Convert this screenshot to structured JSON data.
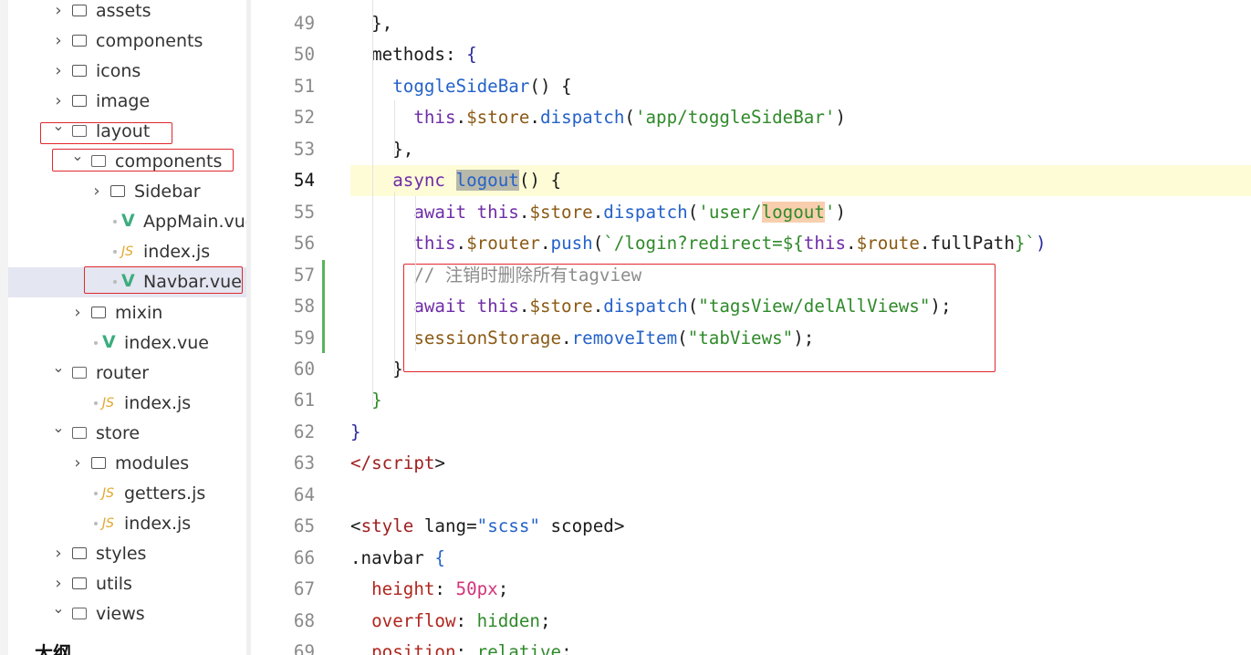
{
  "explorer": {
    "items": [
      {
        "label": "assets",
        "type": "folder",
        "state": "collapsed",
        "depth": 0
      },
      {
        "label": "components",
        "type": "folder",
        "state": "collapsed",
        "depth": 0
      },
      {
        "label": "icons",
        "type": "folder",
        "state": "collapsed",
        "depth": 0
      },
      {
        "label": "image",
        "type": "folder",
        "state": "collapsed",
        "depth": 0
      },
      {
        "label": "layout",
        "type": "folder",
        "state": "expanded",
        "depth": 0
      },
      {
        "label": "components",
        "type": "folder",
        "state": "expanded",
        "depth": 1
      },
      {
        "label": "Sidebar",
        "type": "folder",
        "state": "collapsed",
        "depth": 2
      },
      {
        "label": "AppMain.vue",
        "type": "vue",
        "depth": 2
      },
      {
        "label": "index.js",
        "type": "js",
        "depth": 2
      },
      {
        "label": "Navbar.vue",
        "type": "vue",
        "depth": 2,
        "selected": true
      },
      {
        "label": "mixin",
        "type": "folder",
        "state": "collapsed",
        "depth": 1
      },
      {
        "label": "index.vue",
        "type": "vue",
        "depth": 1
      },
      {
        "label": "router",
        "type": "folder",
        "state": "expanded",
        "depth": 0
      },
      {
        "label": "index.js",
        "type": "js",
        "depth": 1
      },
      {
        "label": "store",
        "type": "folder",
        "state": "expanded",
        "depth": 0
      },
      {
        "label": "modules",
        "type": "folder",
        "state": "collapsed",
        "depth": 1
      },
      {
        "label": "getters.js",
        "type": "js",
        "depth": 1
      },
      {
        "label": "index.js",
        "type": "js",
        "depth": 1
      },
      {
        "label": "styles",
        "type": "folder",
        "state": "collapsed",
        "depth": 0
      },
      {
        "label": "utils",
        "type": "folder",
        "state": "collapsed",
        "depth": 0
      },
      {
        "label": "views",
        "type": "folder",
        "state": "expanded",
        "depth": 0
      }
    ],
    "outline_title": "大纲",
    "file_icon_js": "JS",
    "file_icon_vue": "V"
  },
  "editor": {
    "current_line": 54,
    "lines": [
      {
        "n": "49",
        "tokens": [
          {
            "t": "  },",
            "c": ""
          }
        ]
      },
      {
        "n": "50",
        "tokens": [
          {
            "t": "  methods: ",
            "c": ""
          },
          {
            "t": "{",
            "c": "brace"
          }
        ]
      },
      {
        "n": "51",
        "tokens": [
          {
            "t": "    ",
            "c": ""
          },
          {
            "t": "toggleSideBar",
            "c": "fn"
          },
          {
            "t": "() {",
            "c": ""
          }
        ]
      },
      {
        "n": "52",
        "tokens": [
          {
            "t": "      ",
            "c": ""
          },
          {
            "t": "this",
            "c": "kw"
          },
          {
            "t": ".",
            "c": ""
          },
          {
            "t": "$store",
            "c": "prop"
          },
          {
            "t": ".",
            "c": ""
          },
          {
            "t": "dispatch",
            "c": "fn"
          },
          {
            "t": "(",
            "c": ""
          },
          {
            "t": "'app/toggleSideBar'",
            "c": "str"
          },
          {
            "t": ")",
            "c": ""
          }
        ]
      },
      {
        "n": "53",
        "tokens": [
          {
            "t": "    },",
            "c": ""
          }
        ]
      },
      {
        "n": "54",
        "tokens": [
          {
            "t": "    ",
            "c": ""
          },
          {
            "t": "async ",
            "c": "kw"
          },
          {
            "t": "logout",
            "c": "fn hl-grey"
          },
          {
            "t": "() {",
            "c": ""
          }
        ]
      },
      {
        "n": "55",
        "tokens": [
          {
            "t": "      ",
            "c": ""
          },
          {
            "t": "await ",
            "c": "kw"
          },
          {
            "t": "this",
            "c": "kw"
          },
          {
            "t": ".",
            "c": ""
          },
          {
            "t": "$store",
            "c": "prop"
          },
          {
            "t": ".",
            "c": ""
          },
          {
            "t": "dispatch",
            "c": "fn"
          },
          {
            "t": "(",
            "c": ""
          },
          {
            "t": "'user/",
            "c": "str"
          },
          {
            "t": "logout",
            "c": "str hl-orange"
          },
          {
            "t": "'",
            "c": "str"
          },
          {
            "t": ")",
            "c": ""
          }
        ]
      },
      {
        "n": "56",
        "tokens": [
          {
            "t": "      ",
            "c": ""
          },
          {
            "t": "this",
            "c": "kw"
          },
          {
            "t": ".",
            "c": ""
          },
          {
            "t": "$router",
            "c": "prop"
          },
          {
            "t": ".",
            "c": ""
          },
          {
            "t": "push",
            "c": "fn"
          },
          {
            "t": "(",
            "c": ""
          },
          {
            "t": "`/login?redirect=${",
            "c": "str"
          },
          {
            "t": "this",
            "c": "kw"
          },
          {
            "t": ".",
            "c": ""
          },
          {
            "t": "$route",
            "c": "prop"
          },
          {
            "t": ".fullPath",
            "c": ""
          },
          {
            "t": "}`",
            "c": "str"
          },
          {
            "t": ")",
            "c": "brace"
          }
        ]
      },
      {
        "n": "57",
        "tokens": [
          {
            "t": "      ",
            "c": ""
          },
          {
            "t": "// 注销时删除所有tagview",
            "c": "cmt"
          }
        ]
      },
      {
        "n": "58",
        "tokens": [
          {
            "t": "      ",
            "c": ""
          },
          {
            "t": "await ",
            "c": "kw"
          },
          {
            "t": "this",
            "c": "kw"
          },
          {
            "t": ".",
            "c": ""
          },
          {
            "t": "$store",
            "c": "prop"
          },
          {
            "t": ".",
            "c": ""
          },
          {
            "t": "dispatch",
            "c": "fn"
          },
          {
            "t": "(",
            "c": ""
          },
          {
            "t": "\"tagsView/delAllViews\"",
            "c": "str"
          },
          {
            "t": ");",
            "c": ""
          }
        ]
      },
      {
        "n": "59",
        "tokens": [
          {
            "t": "      ",
            "c": ""
          },
          {
            "t": "sessionStorage",
            "c": "prop"
          },
          {
            "t": ".",
            "c": ""
          },
          {
            "t": "removeItem",
            "c": "fn"
          },
          {
            "t": "(",
            "c": ""
          },
          {
            "t": "\"tabViews\"",
            "c": "str"
          },
          {
            "t": ");",
            "c": ""
          }
        ]
      },
      {
        "n": "60",
        "tokens": [
          {
            "t": "    }",
            "c": ""
          }
        ]
      },
      {
        "n": "61",
        "tokens": [
          {
            "t": "  }",
            "c": "str"
          }
        ]
      },
      {
        "n": "62",
        "tokens": [
          {
            "t": "}",
            "c": "brace"
          }
        ]
      },
      {
        "n": "63",
        "tokens": [
          {
            "t": "</",
            "c": "tag"
          },
          {
            "t": "script",
            "c": "tag"
          },
          {
            "t": ">",
            "c": ""
          }
        ]
      },
      {
        "n": "64",
        "tokens": [
          {
            "t": "",
            "c": ""
          }
        ]
      },
      {
        "n": "65",
        "tokens": [
          {
            "t": "<",
            "c": ""
          },
          {
            "t": "style",
            "c": "tag"
          },
          {
            "t": " lang=",
            "c": ""
          },
          {
            "t": "\"scss\"",
            "c": "fn"
          },
          {
            "t": " scoped>",
            "c": ""
          }
        ]
      },
      {
        "n": "66",
        "tokens": [
          {
            "t": ".navbar ",
            "c": ""
          },
          {
            "t": "{",
            "c": "fn"
          }
        ]
      },
      {
        "n": "67",
        "tokens": [
          {
            "t": "  ",
            "c": ""
          },
          {
            "t": "height",
            "c": "cssprop"
          },
          {
            "t": ": ",
            "c": ""
          },
          {
            "t": "50px",
            "c": "num"
          },
          {
            "t": ";",
            "c": ""
          }
        ]
      },
      {
        "n": "68",
        "tokens": [
          {
            "t": "  ",
            "c": ""
          },
          {
            "t": "overflow",
            "c": "cssprop"
          },
          {
            "t": ": ",
            "c": ""
          },
          {
            "t": "hidden",
            "c": "str"
          },
          {
            "t": ";",
            "c": ""
          }
        ]
      },
      {
        "n": "69",
        "tokens": [
          {
            "t": "  ",
            "c": ""
          },
          {
            "t": "position",
            "c": "cssprop"
          },
          {
            "t": ": ",
            "c": ""
          },
          {
            "t": "relative",
            "c": "str"
          },
          {
            "t": ";",
            "c": ""
          }
        ]
      }
    ]
  }
}
